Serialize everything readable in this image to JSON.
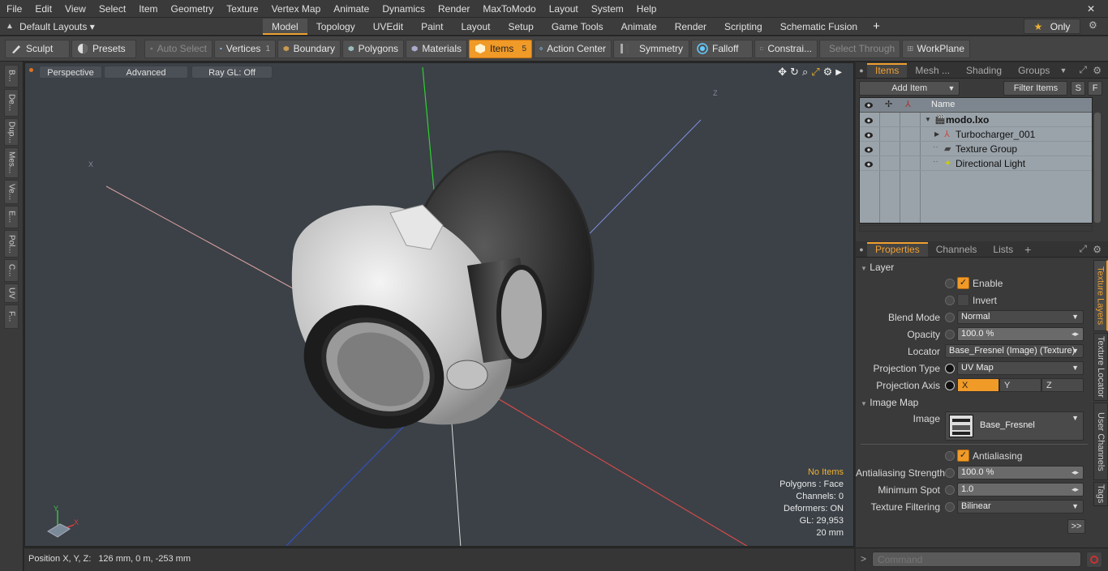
{
  "menu": {
    "items": [
      "File",
      "Edit",
      "View",
      "Select",
      "Item",
      "Geometry",
      "Texture",
      "Vertex Map",
      "Animate",
      "Dynamics",
      "Render",
      "MaxToModo",
      "Layout",
      "System",
      "Help"
    ],
    "close_glyph": "✕"
  },
  "layouts": {
    "selector_label": "Default Layouts",
    "tabs": [
      "Model",
      "Topology",
      "UVEdit",
      "Paint",
      "Layout",
      "Setup",
      "Game Tools",
      "Animate",
      "Render",
      "Scripting",
      "Schematic Fusion"
    ],
    "active_tab": "Model",
    "add_glyph": "+",
    "only_label": "Only",
    "only_icon": "star-icon"
  },
  "toolbar": {
    "sculpt": "Sculpt",
    "presets": "Presets",
    "auto_select": "Auto Select",
    "vertices": "Vertices",
    "vertices_count": "1",
    "boundary": "Boundary",
    "polygons": "Polygons",
    "materials": "Materials",
    "items": "Items",
    "items_count": "5",
    "action_center": "Action Center",
    "symmetry": "Symmetry",
    "falloff": "Falloff",
    "constraints": "Constrai...",
    "select_through": "Select Through",
    "workplane": "WorkPlane"
  },
  "left_tabs": [
    "B...",
    "De...",
    "Dup...",
    "Mes...",
    "Ve...",
    "E...",
    "Pol...",
    "C...",
    "UV",
    "F..."
  ],
  "viewport": {
    "view_mode": "Perspective",
    "shading": "Advanced",
    "raygl": "Ray GL: Off",
    "stats": {
      "no_items": "No Items",
      "polygons": "Polygons : Face",
      "channels": "Channels: 0",
      "deformers": "Deformers: ON",
      "gl": "GL: 29,953",
      "unit": "20 mm"
    },
    "axis_x_label": "X",
    "axis_y_label": "Y"
  },
  "statusbar": {
    "position_label": "Position X, Y, Z:",
    "position_value": "126 mm, 0 m, -253 mm"
  },
  "items_panel": {
    "tabs": [
      "Items",
      "Mesh ...",
      "Shading",
      "Groups"
    ],
    "active_tab": "Items",
    "add_item": "Add Item",
    "filter_items": "Filter Items",
    "s_btn": "S",
    "f_btn": "F",
    "name_header": "Name",
    "tree": [
      {
        "name": "modo.lxo",
        "bold": true,
        "indent": 0,
        "expander": "▼",
        "icon": "scene-icon"
      },
      {
        "name": "Turbocharger_001",
        "bold": false,
        "indent": 1,
        "expander": "▶",
        "icon": "locator-icon"
      },
      {
        "name": "Texture Group",
        "bold": false,
        "indent": 1,
        "expander": "",
        "icon": "texture-group-icon"
      },
      {
        "name": "Directional Light",
        "bold": false,
        "indent": 1,
        "expander": "",
        "icon": "light-icon"
      }
    ]
  },
  "properties": {
    "tabs": [
      "Properties",
      "Channels",
      "Lists"
    ],
    "active_tab": "Properties",
    "add_glyph": "+",
    "layer_section": "Layer",
    "enable_label": "Enable",
    "invert_label": "Invert",
    "blend_mode_label": "Blend Mode",
    "blend_mode_value": "Normal",
    "opacity_label": "Opacity",
    "opacity_value": "100.0 %",
    "locator_label": "Locator",
    "locator_value": "Base_Fresnel (Image) (Texture)",
    "projection_type_label": "Projection Type",
    "projection_type_value": "UV Map",
    "projection_axis_label": "Projection Axis",
    "axis_options": [
      "X",
      "Y",
      "Z"
    ],
    "axis_selected": "X",
    "image_map_section": "Image Map",
    "image_label": "Image",
    "image_value": "Base_Fresnel",
    "antialiasing_label": "Antialiasing",
    "aa_strength_label": "Antialiasing Strength",
    "aa_strength_value": "100.0 %",
    "min_spot_label": "Minimum Spot",
    "min_spot_value": "1.0",
    "tex_filter_label": "Texture Filtering",
    "tex_filter_value": "Bilinear",
    "more_glyph": ">>",
    "side_tabs": [
      "Texture Layers",
      "Texture Locator",
      "User Channels",
      "Tags"
    ],
    "active_side_tab": "Texture Layers",
    "enable_checked": true,
    "invert_checked": false,
    "antialiasing_checked": true
  },
  "command": {
    "placeholder": "Command",
    "prompt_glyph": ">"
  }
}
